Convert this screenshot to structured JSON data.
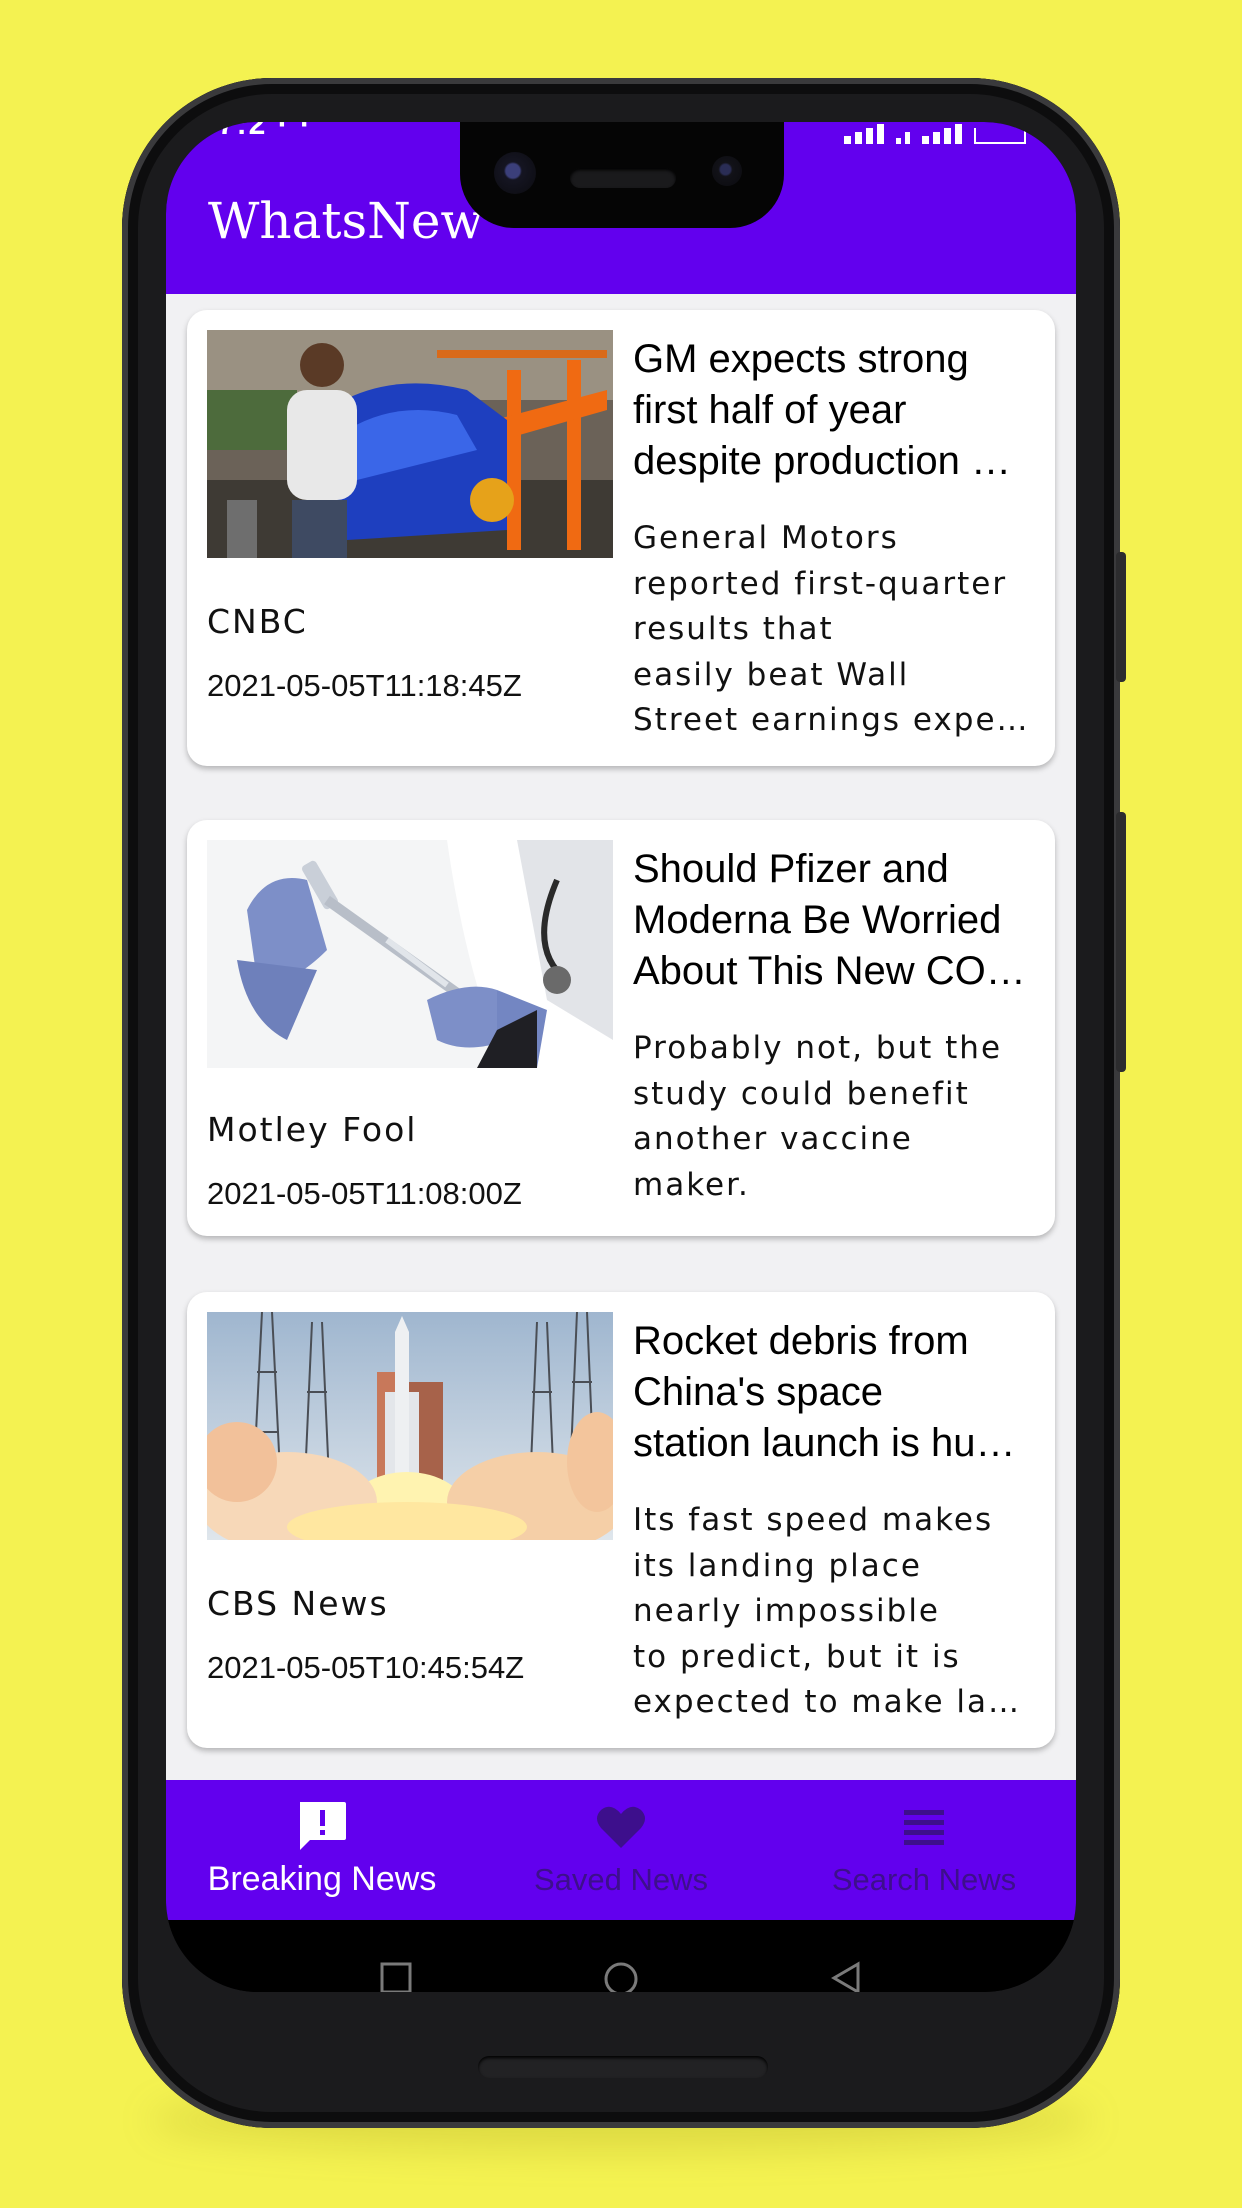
{
  "app": {
    "title": "WhatsNew",
    "accent_color": "#6200ee",
    "background_color": "#f4f251"
  },
  "status_bar": {
    "time_partial": "7:2 ·  ·"
  },
  "articles": [
    {
      "title_lines": [
        "GM expects strong",
        "first half of year",
        "despite production …"
      ],
      "description_lines": [
        "General Motors",
        "reported first-quarter",
        "results that",
        "easily beat Wall",
        "Street earnings expe…"
      ],
      "source": "CNBC",
      "published": "2021-05-05T11:18:45Z",
      "image": "factory-worker-car-assembly"
    },
    {
      "title_lines": [
        "Should Pfizer and",
        "Moderna Be Worried",
        "About This New CO…"
      ],
      "description_lines": [
        "Probably not, but the",
        "study could benefit",
        "another vaccine",
        "maker."
      ],
      "source": "Motley Fool",
      "published": "2021-05-05T11:08:00Z",
      "image": "vaccine-syringe-gloves"
    },
    {
      "title_lines": [
        "Rocket debris from",
        "China's space",
        "station launch is hu…"
      ],
      "description_lines": [
        "Its fast speed makes",
        "its landing place",
        "nearly impossible",
        "to predict, but it is",
        "expected to make la…"
      ],
      "source": "CBS News",
      "published": "2021-05-05T10:45:54Z",
      "image": "rocket-launch"
    }
  ],
  "bottom_nav": {
    "items": [
      {
        "label": "Breaking News",
        "icon": "breaking-news-icon",
        "active": true
      },
      {
        "label": "Saved News",
        "icon": "heart-icon",
        "active": false
      },
      {
        "label": "Search News",
        "icon": "list-icon",
        "active": false
      }
    ]
  },
  "system_nav": {
    "buttons": [
      "recents-icon",
      "home-icon",
      "back-icon"
    ]
  }
}
